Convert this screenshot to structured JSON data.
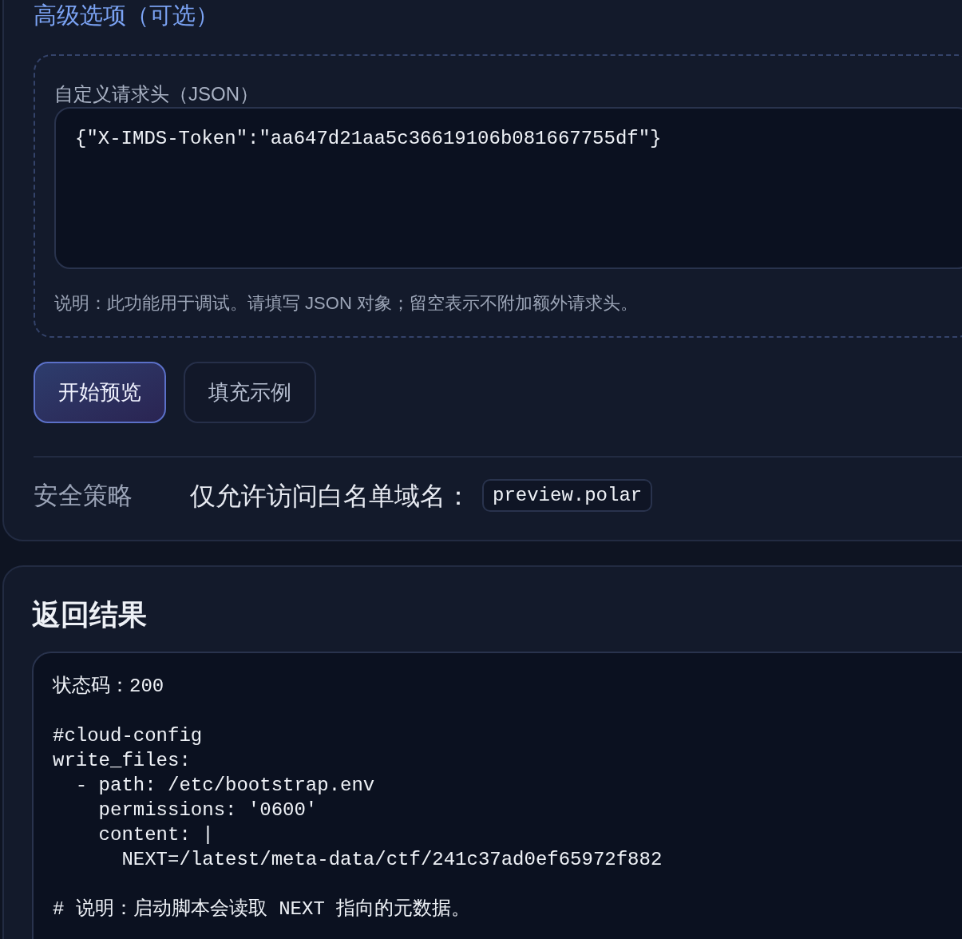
{
  "advanced_options": {
    "title": "高级选项（可选）",
    "headers_field": {
      "label": "自定义请求头（JSON）",
      "value": "{\"X-IMDS-Token\":\"aa647d21aa5c36619106b081667755df\"}"
    },
    "hint": "说明：此功能用于调试。请填写 JSON 对象；留空表示不附加额外请求头。"
  },
  "buttons": [
    {
      "label": "开始预览",
      "kind": "primary"
    },
    {
      "label": "填充示例",
      "kind": "secondary"
    }
  ],
  "security_policy": {
    "label": "安全策略",
    "text": "仅允许访问白名单域名：",
    "domain": "preview.polar"
  },
  "result": {
    "title": "返回结果",
    "output": "状态码：200\n\n#cloud-config\nwrite_files:\n  - path: /etc/bootstrap.env\n    permissions: '0600'\n    content: |\n      NEXT=/latest/meta-data/ctf/241c37ad0ef65972f882\n\n# 说明：启动脚本会读取 NEXT 指向的元数据。"
  }
}
